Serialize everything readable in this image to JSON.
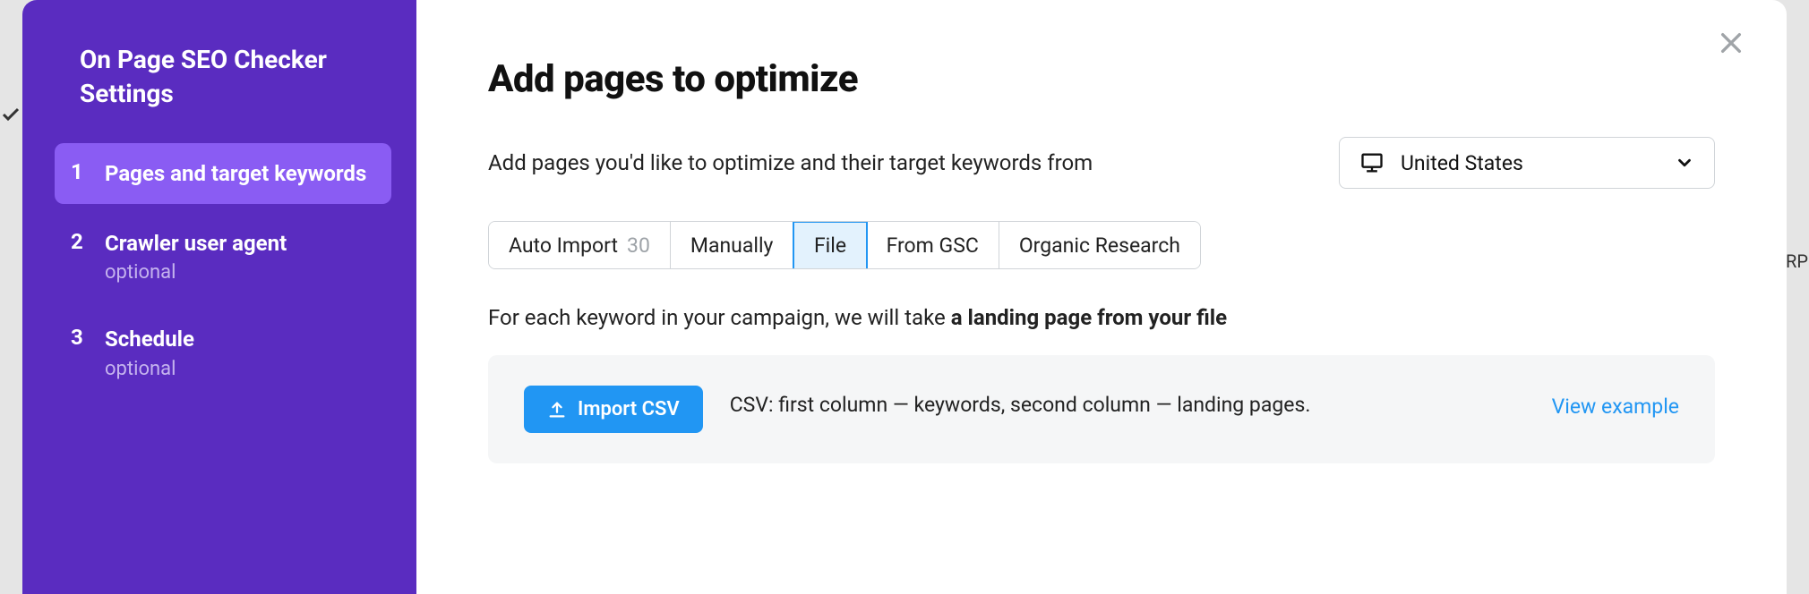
{
  "sidebar": {
    "title": "On Page SEO Checker Settings",
    "steps": [
      {
        "num": "1",
        "label": "Pages and target keywords",
        "sub": "",
        "active": true
      },
      {
        "num": "2",
        "label": "Crawler user agent",
        "sub": "optional",
        "active": false
      },
      {
        "num": "3",
        "label": "Schedule",
        "sub": "optional",
        "active": false
      }
    ]
  },
  "main": {
    "title": "Add pages to optimize",
    "intro": "Add pages you'd like to optimize and their target keywords from",
    "locale": "United States",
    "tabs": [
      {
        "label": "Auto Import",
        "count": "30"
      },
      {
        "label": "Manually"
      },
      {
        "label": "File",
        "active": true
      },
      {
        "label": "From GSC"
      },
      {
        "label": "Organic Research"
      }
    ],
    "description_prefix": "For each keyword in your campaign, we will take ",
    "description_bold": "a landing page from your file",
    "import": {
      "button": "Import CSV",
      "desc": "CSV: first column — keywords, second column — landing pages.",
      "link": "View example"
    }
  },
  "bg": {
    "right_text": "RP F"
  }
}
